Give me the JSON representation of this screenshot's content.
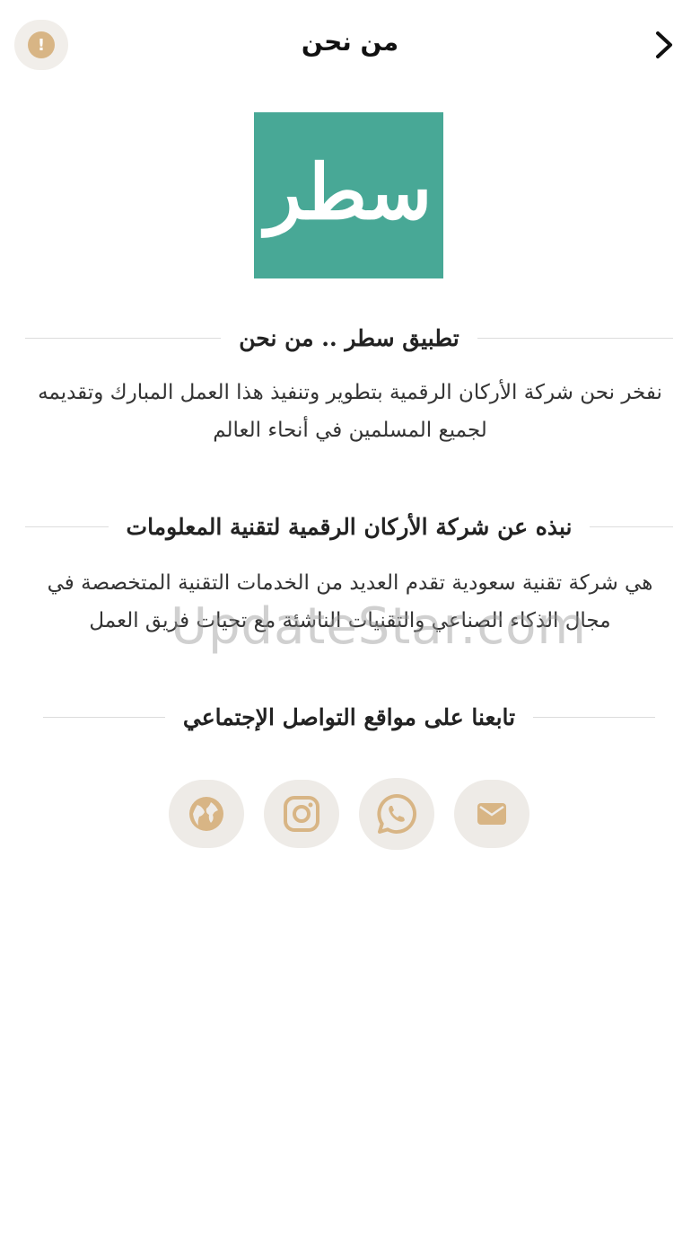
{
  "header": {
    "title": "من نحن",
    "info_icon": "info-icon",
    "back_icon": "chevron-right-icon"
  },
  "logo": {
    "text": "سطر",
    "bg_color": "#48a896"
  },
  "sections": [
    {
      "title": "تطبيق سطر  ..  من نحن",
      "body": "نفخر نحن شركة الأركان الرقمية بتطوير وتنفيذ هذا العمل المبارك وتقديمه لجميع المسلمين في أنحاء العالم"
    },
    {
      "title": "نبذه عن شركة الأركان الرقمية لتقنية المعلومات",
      "body": "هي شركة تقنية سعودية تقدم العديد من الخدمات التقنية المتخصصة في مجال الذكاء الصناعي والتقنيات الناشئة مع تحيات فريق العمل"
    },
    {
      "title": "تابعنا على مواقع التواصل الإجتماعي"
    }
  ],
  "social": {
    "accent_color": "#d8b585",
    "items": [
      {
        "icon": "globe-icon"
      },
      {
        "icon": "instagram-icon"
      },
      {
        "icon": "whatsapp-icon"
      },
      {
        "icon": "email-icon"
      }
    ]
  },
  "watermark": "UpdateStar.com"
}
